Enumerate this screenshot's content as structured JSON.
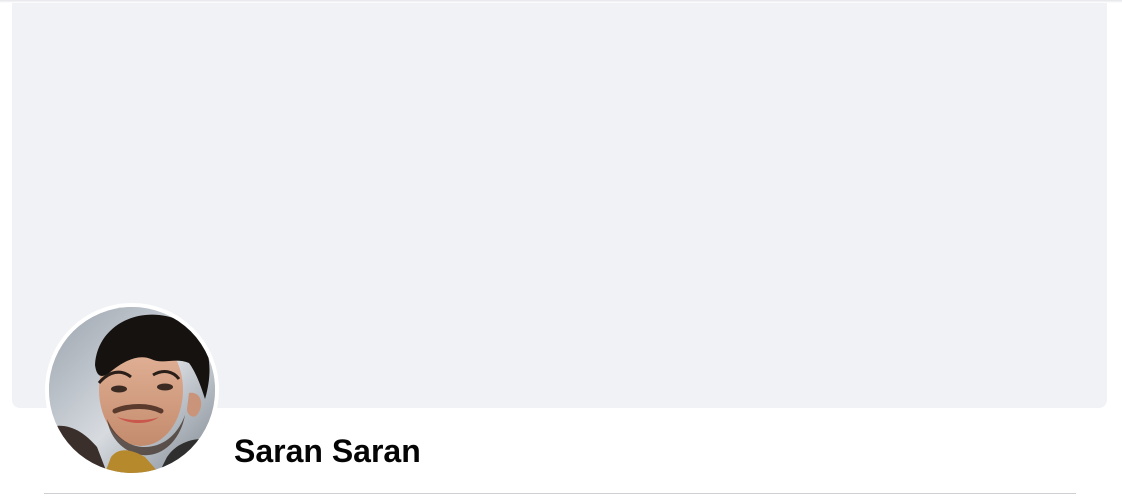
{
  "profile": {
    "name": "Saran Saran",
    "avatar_icon": "profile-photo"
  },
  "cover": {
    "color": "#f0f2f5"
  },
  "colors": {
    "background": "#ffffff",
    "name_text": "#050505",
    "divider": "#ced0d4"
  }
}
